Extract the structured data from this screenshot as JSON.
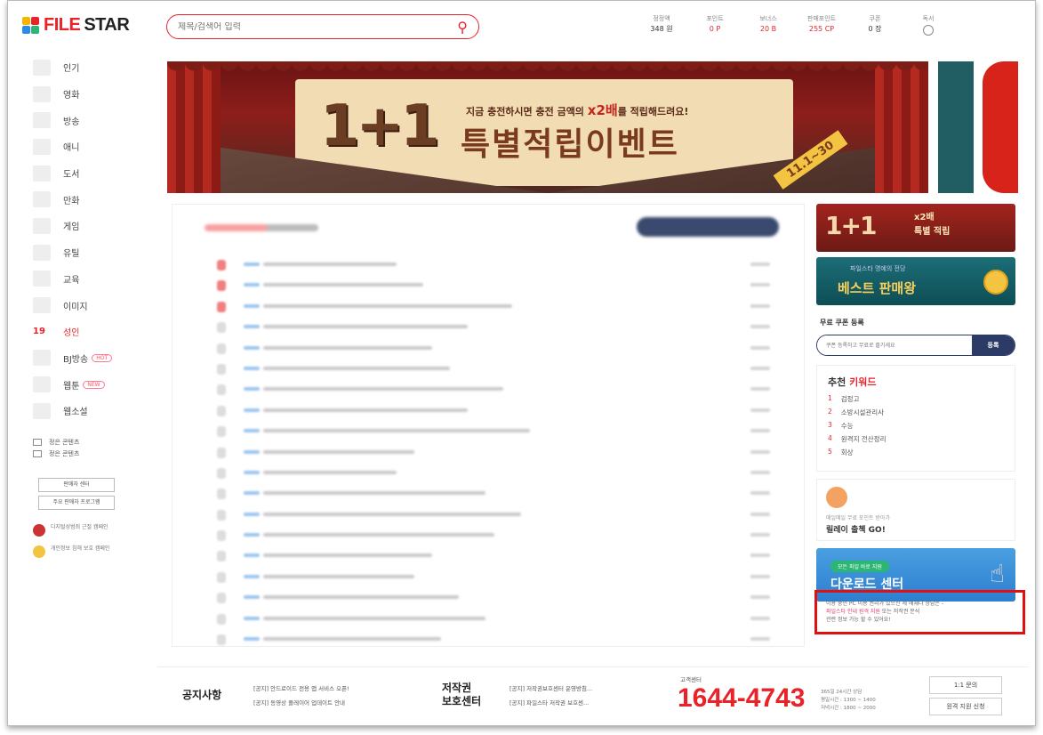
{
  "header": {
    "logo_text_1": "FILE",
    "logo_text_2": "STAR",
    "search_placeholder": "제목/검색어 입력",
    "stats": [
      {
        "label": "정정액",
        "value": "348 원",
        "red": false
      },
      {
        "label": "포인트",
        "value": "0 P",
        "red": true
      },
      {
        "label": "보너스",
        "value": "20 B",
        "red": true
      },
      {
        "label": "판매포인트",
        "value": "255 CP",
        "red": true
      },
      {
        "label": "쿠폰",
        "value": "0 장",
        "red": false
      }
    ],
    "last_stat_label": "독서"
  },
  "sidebar": {
    "items": [
      {
        "label": "인기"
      },
      {
        "label": "영화"
      },
      {
        "label": "방송"
      },
      {
        "label": "애니"
      },
      {
        "label": "도서"
      },
      {
        "label": "만화"
      },
      {
        "label": "게임"
      },
      {
        "label": "유틸"
      },
      {
        "label": "교육"
      },
      {
        "label": "이미지"
      }
    ],
    "adult": {
      "num": "19",
      "label": "성인"
    },
    "bj": {
      "label": "BJ방송",
      "pill": "HOT"
    },
    "webtoon": {
      "label": "웹툰",
      "pill": "NEW"
    },
    "webnovel": {
      "label": "웹소설"
    },
    "mini_links": [
      "정은 콘텐츠",
      "정은 콘텐츠"
    ],
    "buttons": [
      "판매자 센터",
      "주요 판매자 프로그램"
    ],
    "promos": [
      {
        "text": "디지털성범죄 근절 캠페인"
      },
      {
        "text": "개인정보 침해 보호 캠페인"
      }
    ]
  },
  "banner": {
    "big": "1+1",
    "sub": "지금 충전하시면 충전 금액의",
    "sub_bold": "x2배",
    "sub_tail": "를 적립해드려요!",
    "main": "특별적립이벤트",
    "date": "11.1~30"
  },
  "right": {
    "ad1_big": "1+1",
    "ad1_line1": "x2배",
    "ad1_line2": "특별 적립",
    "ad2_small": "파일스타 명예의 전당",
    "ad2_main": "베스트 판매왕",
    "coupon_title": "무료 쿠폰 등록",
    "coupon_placeholder": "쿠폰 등록하고 무료로 즐기세요",
    "coupon_button": "등록",
    "keywords_title_a": "추천",
    "keywords_title_b": "키워드",
    "keywords": [
      {
        "rank": "1",
        "text": "검정고"
      },
      {
        "rank": "2",
        "text": "소방시설관리사"
      },
      {
        "rank": "3",
        "text": "수능"
      },
      {
        "rank": "4",
        "text": "원격지 전산정리"
      },
      {
        "rank": "5",
        "text": "회상"
      }
    ],
    "attendance_small": "매일매일 무료 포인트 받아가",
    "attendance_main": "릴레이 출첵 GO!",
    "download_chip": "모든 파일 바로 지원",
    "download_main": "다운로드 센터",
    "notice_1": "이용 중인 PC 이용 권리가 있으신 세 매체나 상담은 -",
    "notice_pink": "파일스타 안내 원격 지원",
    "notice_2": "또는 저작권 분석",
    "notice_3": "관련 정보 가능 할 수 있어요!"
  },
  "list": {
    "row_bars": [
      150,
      180,
      280,
      230,
      190,
      210,
      270,
      230,
      300,
      170,
      150,
      250,
      290,
      260,
      190,
      170,
      220,
      250,
      200
    ]
  },
  "footer": {
    "notice_title": "공지사항",
    "notices": [
      "[공지] 안드로이드 전용 앱 서비스 오픈!",
      "[공지] 동영상 플레이어 업데이트 안내"
    ],
    "copyright_title_1": "저작권",
    "copyright_title_2": "보호센터",
    "copyright_items": [
      "[공지] 저작권보호센터 운영방침...",
      "[공지] 파일스타 저작권 보호센..."
    ],
    "cs_label": "고객센터",
    "phone": "1644-4743",
    "hours_1": "365일 24시간 상담",
    "hours_2": "평일시간 : 1300 ~ 1400",
    "hours_3": "저녁시간 : 1800 ~ 2000",
    "btn_1": "1:1 문의",
    "btn_2": "원격 지원 신청"
  },
  "colors": {
    "brand": "#e8232a",
    "navy": "#2c3a66"
  }
}
